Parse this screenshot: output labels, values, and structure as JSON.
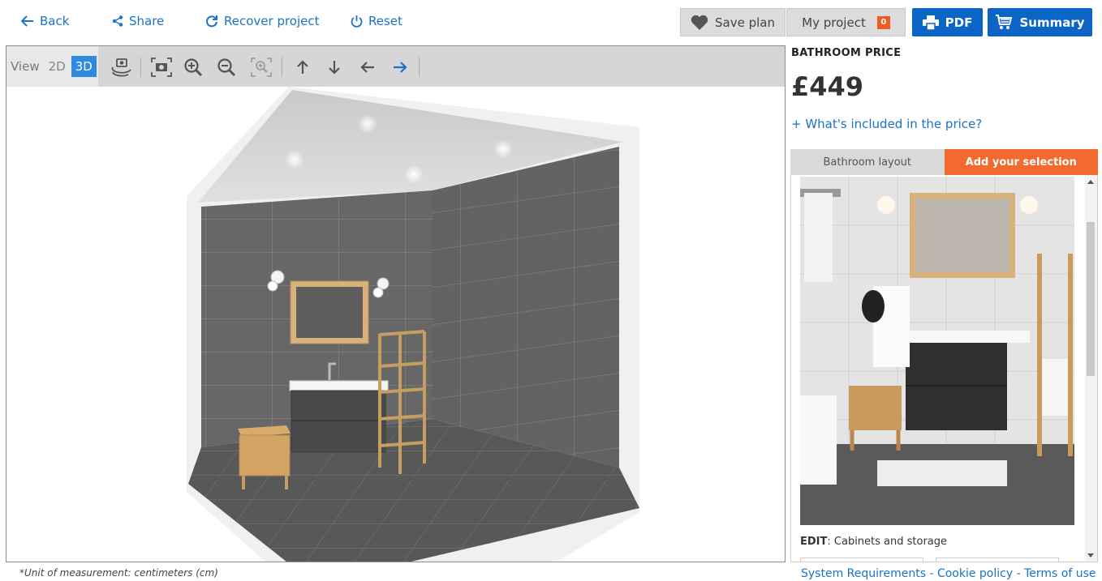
{
  "topbar": {
    "back_label": "Back",
    "share_label": "Share",
    "recover_label": "Recover project",
    "reset_label": "Reset",
    "save_plan_label": "Save plan",
    "my_project_label": "My project",
    "my_project_count": "0",
    "pdf_label": "PDF",
    "summary_label": "Summary"
  },
  "viewer": {
    "view_label": "View",
    "view_2d": "2D",
    "view_3d": "3D",
    "selected_view": "3D",
    "tools": [
      "rotate-camera-icon",
      "camera-icon",
      "zoom-in-icon",
      "zoom-out-icon",
      "zoom-fit-icon",
      "arrow-up-icon",
      "arrow-down-icon",
      "arrow-left-icon",
      "arrow-right-icon"
    ]
  },
  "price_panel": {
    "heading": "BATHROOM PRICE",
    "price": "£449",
    "included_link": "+ What's included in the price?",
    "tab_layout": "Bathroom layout",
    "tab_selection": "Add your selection",
    "active_tab": "Add your selection",
    "edit_prefix": "EDIT",
    "edit_value": ": Cabinets and storage"
  },
  "footer": {
    "unit_note": "*Unit of measurement: centimeters (cm)",
    "system_requirements": "System Requirements",
    "cookie_policy": "Cookie policy",
    "terms_of_use": "Terms of use",
    "separator": " - "
  },
  "colors": {
    "link_blue": "#1a73c8",
    "button_blue": "#0a65c7",
    "accent_orange": "#f26a2d",
    "toggle_active": "#2d8ae0"
  }
}
